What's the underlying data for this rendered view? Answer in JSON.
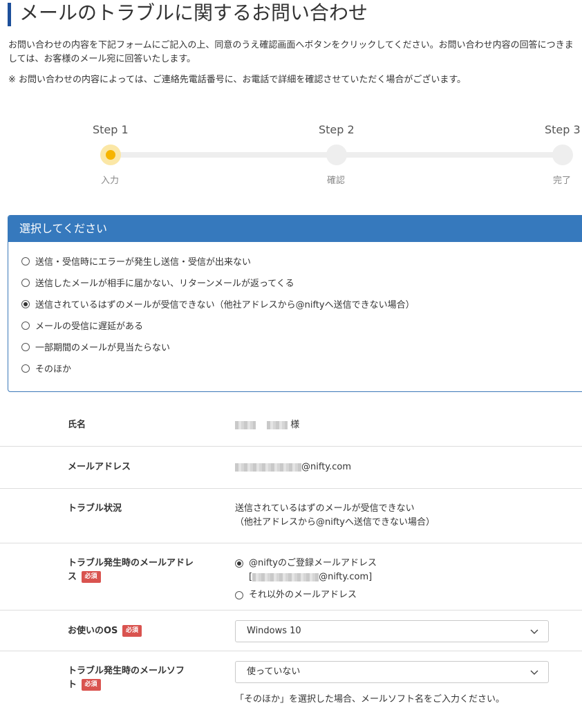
{
  "page": {
    "title": "メールのトラブルに関するお問い合わせ",
    "intro": "お問い合わせの内容を下記フォームにご記入の上、同意のうえ確認画面へボタンをクリックしてください。お問い合わせ内容の回答につきましては、お客様のメール宛に回答いたします。",
    "note": "※ お問い合わせの内容によっては、ご連絡先電話番号に、お電話で詳細を確認させていただく場合がございます。"
  },
  "steps": [
    {
      "label": "Step 1",
      "sub": "入力",
      "state": "active"
    },
    {
      "label": "Step 2",
      "sub": "確認",
      "state": "pending"
    },
    {
      "label": "Step 3",
      "sub": "完了",
      "state": "pending"
    }
  ],
  "select_panel": {
    "header": "選択してください",
    "selected_index": 2,
    "options": [
      "送信・受信時にエラーが発生し送信・受信が出来ない",
      "送信したメールが相手に届かない、リターンメールが返ってくる",
      "送信されているはずのメールが受信できない（他社アドレスから@niftyへ送信できない場合）",
      "メールの受信に遅延がある",
      "一部期間のメールが見当たらない",
      "そのほか"
    ]
  },
  "form": {
    "name": {
      "label": "氏名",
      "suffix": "様"
    },
    "email": {
      "label": "メールアドレス",
      "domain": "@nifty.com"
    },
    "trouble": {
      "label": "トラブル状況",
      "line1": "送信されているはずのメールが受信できない",
      "line2": "（他社アドレスから@niftyへ送信できない場合）"
    },
    "trouble_address": {
      "label_line1": "トラブル発生時のメールアドレ",
      "label_line2": "ス",
      "required": "必須",
      "option1": "@niftyのご登録メールアドレス",
      "option1_domain": "@nifty.com]",
      "option1_bracket": "[",
      "option2": "それ以外のメールアドレス"
    },
    "os": {
      "label": "お使いのOS",
      "required": "必須",
      "value": "Windows 10"
    },
    "mail_soft": {
      "label_line1": "トラブル発生時のメールソフ",
      "label_line2": "ト",
      "required": "必須",
      "value": "使っていない",
      "help": "「そのほか」を選択した場合、メールソフト名をご入力ください。"
    }
  },
  "colors": {
    "accent": "#3679bd",
    "title_bar": "#1d4f9a",
    "step_active": "#f6b400",
    "required_badge": "#d9534f"
  }
}
